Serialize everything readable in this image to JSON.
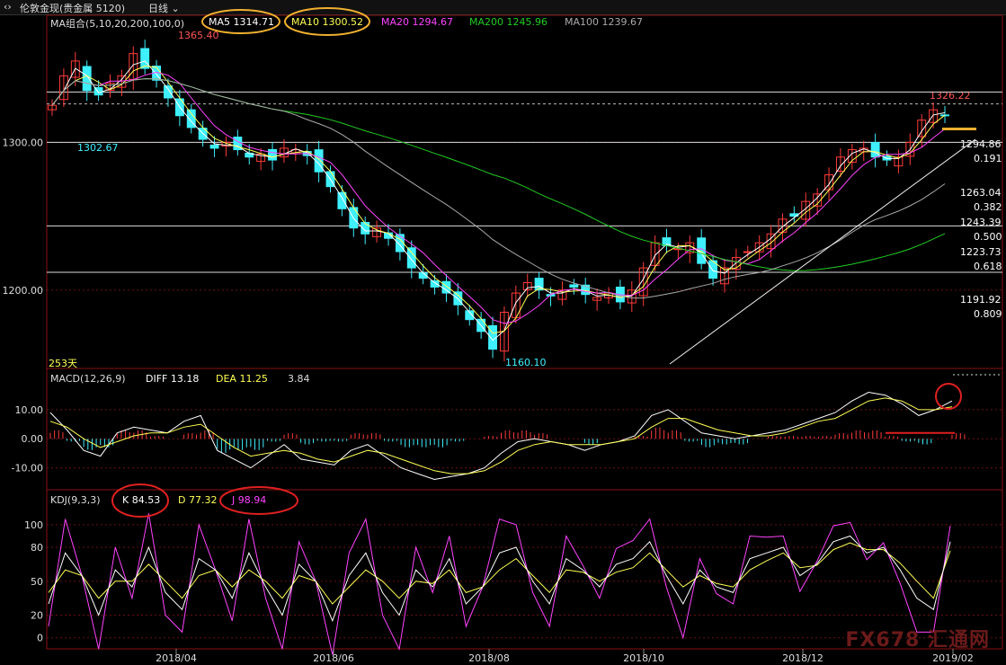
{
  "topbar": {
    "icon": "chevron-back-forward-icon",
    "instrument": "伦敦金现(贵金属 5120)",
    "period": "日线"
  },
  "main_legend": {
    "ma_group": "MA组合(5,10,20,200,100,0)",
    "ma5": "MA5 1314.71",
    "ma10": "MA10 1300.52",
    "ma20": "MA20 1294.67",
    "ma200": "MA200 1245.96",
    "ma100": "MA100 1239.67"
  },
  "macd_legend": {
    "name": "MACD(12,26,9)",
    "diff": "DIFF 13.18",
    "dea": "DEA 11.25",
    "macd": "3.84"
  },
  "kdj_legend": {
    "name": "KDJ(9,3,3)",
    "k": "K 84.53",
    "d": "D 77.32",
    "j": "J 98.94"
  },
  "annotations": {
    "high": "1365.40",
    "low": "1160.10",
    "mid": "1302.67",
    "last_high": "1326.22",
    "days": "253天"
  },
  "fib_levels": [
    {
      "price": "1294.86",
      "ratio": "0.191"
    },
    {
      "price": "1263.04",
      "ratio": "0.382"
    },
    {
      "price": "1243.39",
      "ratio": "0.500"
    },
    {
      "price": "1223.73",
      "ratio": "0.618"
    },
    {
      "price": "1191.92",
      "ratio": "0.809"
    }
  ],
  "colors": {
    "up": "#ff3b3b",
    "down": "#3ff0ff",
    "ma5": "#ffffff",
    "ma10": "#ffff55",
    "ma20": "#ff44ff",
    "ma200": "#22cc22",
    "ma100": "#aaaaaa",
    "highlight": "#f0b030",
    "alert": "#e02020"
  },
  "watermark": "FX678 汇通网",
  "chart_data": [
    {
      "type": "candlestick",
      "title": "伦敦金现 日线",
      "x_ticks": [
        "2018/04",
        "2018/06",
        "2018/08",
        "2018/10",
        "2018/12",
        "2019/02"
      ],
      "y_ticks": [
        1300,
        1200
      ],
      "ylim": [
        1150,
        1375
      ],
      "horizontal_lines": [
        1334,
        1326,
        1300,
        1243.4,
        1212
      ],
      "series_ma": [
        "MA5",
        "MA10",
        "MA20",
        "MA200",
        "MA100"
      ],
      "price_path": [
        1325,
        1345,
        1355,
        1335,
        1332,
        1340,
        1345,
        1360,
        1350,
        1342,
        1330,
        1318,
        1310,
        1302,
        1296,
        1300,
        1295,
        1290,
        1292,
        1288,
        1296,
        1295,
        1291,
        1280,
        1270,
        1255,
        1242,
        1238,
        1242,
        1235,
        1226,
        1215,
        1208,
        1202,
        1198,
        1190,
        1180,
        1172,
        1160,
        1185,
        1198,
        1205,
        1200,
        1196,
        1200,
        1202,
        1197,
        1195,
        1198,
        1192,
        1200,
        1215,
        1232,
        1230,
        1228,
        1232,
        1218,
        1208,
        1215,
        1222,
        1226,
        1232,
        1238,
        1248,
        1250,
        1260,
        1265,
        1278,
        1290,
        1295,
        1296,
        1290,
        1288,
        1290,
        1300,
        1315,
        1322,
        1318
      ]
    },
    {
      "type": "macd",
      "y_ticks": [
        10,
        0,
        -10
      ],
      "ylim": [
        -16,
        18
      ],
      "diff_path": [
        9,
        3,
        -4,
        -6,
        2,
        4,
        3,
        2,
        6,
        8,
        -4,
        -7,
        -10,
        -6,
        -2,
        -7,
        -8,
        -9,
        -4,
        -2,
        -6,
        -10,
        -12,
        -14,
        -13,
        -12,
        -10,
        -5,
        -1,
        0,
        -1,
        -2,
        -4,
        -2,
        -1,
        1,
        8,
        10,
        6,
        2,
        1,
        0,
        1,
        2,
        3,
        5,
        7,
        9,
        13,
        16,
        15,
        12,
        8,
        10,
        13
      ],
      "dea_path": [
        6,
        4,
        0,
        -3,
        -1,
        1,
        2,
        2,
        4,
        5,
        1,
        -3,
        -6,
        -5,
        -4,
        -5,
        -7,
        -8,
        -6,
        -4,
        -5,
        -7,
        -9,
        -11,
        -12,
        -12,
        -11,
        -8,
        -4,
        -2,
        -1,
        -2,
        -2,
        -2,
        -1,
        0,
        4,
        7,
        7,
        5,
        3,
        2,
        1,
        1,
        2,
        4,
        6,
        7,
        10,
        13,
        14,
        13,
        10,
        10,
        11
      ],
      "hist_path": [
        3,
        -1,
        -4,
        -3,
        3,
        3,
        1,
        0,
        2,
        3,
        -5,
        -4,
        -4,
        -1,
        2,
        -2,
        -1,
        -1,
        2,
        2,
        -1,
        -3,
        -3,
        -3,
        -1,
        0,
        1,
        3,
        3,
        2,
        0,
        0,
        -2,
        0,
        0,
        1,
        4,
        3,
        -1,
        -3,
        -2,
        -2,
        0,
        1,
        1,
        1,
        1,
        2,
        3,
        3,
        1,
        -1,
        -2,
        0,
        2
      ]
    },
    {
      "type": "kdj",
      "y_ticks": [
        100,
        80,
        50,
        20,
        0
      ],
      "ylim": [
        -5,
        115
      ],
      "k_path": [
        30,
        75,
        55,
        20,
        60,
        45,
        80,
        40,
        25,
        70,
        60,
        35,
        75,
        45,
        20,
        65,
        50,
        15,
        55,
        75,
        40,
        20,
        60,
        45,
        70,
        30,
        45,
        75,
        80,
        50,
        30,
        70,
        60,
        45,
        65,
        70,
        85,
        55,
        30,
        60,
        45,
        40,
        70,
        75,
        80,
        55,
        65,
        85,
        90,
        75,
        80,
        60,
        35,
        25,
        85
      ],
      "d_path": [
        40,
        60,
        55,
        35,
        50,
        50,
        65,
        50,
        35,
        55,
        60,
        45,
        60,
        50,
        35,
        55,
        50,
        30,
        45,
        60,
        50,
        35,
        50,
        48,
        60,
        40,
        45,
        60,
        70,
        55,
        40,
        60,
        58,
        50,
        58,
        62,
        75,
        60,
        45,
        55,
        48,
        45,
        60,
        68,
        75,
        62,
        64,
        78,
        84,
        78,
        78,
        66,
        50,
        35,
        77
      ],
      "j_path": [
        10,
        105,
        55,
        -10,
        80,
        35,
        110,
        20,
        5,
        100,
        60,
        15,
        105,
        35,
        -10,
        85,
        50,
        -15,
        75,
        105,
        20,
        -10,
        80,
        40,
        90,
        10,
        45,
        105,
        100,
        40,
        10,
        90,
        64,
        35,
        79,
        86,
        105,
        45,
        0,
        70,
        39,
        30,
        90,
        89,
        90,
        41,
        67,
        99,
        102,
        69,
        84,
        48,
        5,
        5,
        99
      ]
    }
  ]
}
